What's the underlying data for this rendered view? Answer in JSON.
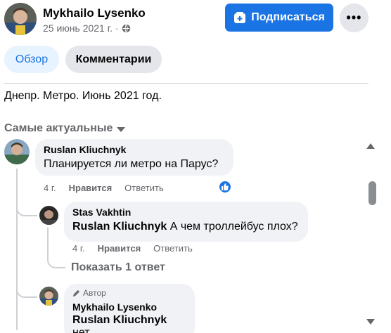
{
  "post": {
    "author": "Mykhailo Lysenko",
    "date": "25 июнь 2021 г. ·",
    "text": "Днепр. Метро. Июнь 2021 год."
  },
  "header": {
    "subscribe_label": "Подписаться",
    "more_label": "•••"
  },
  "tabs": [
    {
      "label": "Обзор",
      "active": true
    },
    {
      "label": "Комментарии",
      "active": false
    }
  ],
  "sort": {
    "label": "Самые актуальные"
  },
  "comments": [
    {
      "author": "Ruslan Kliuchnyk",
      "text": "Планируется ли метро на Парус?",
      "time": "4 г.",
      "like_label": "Нравится",
      "reply_label": "Ответить",
      "reaction": "like"
    },
    {
      "author": "Stas Vakhtin",
      "mention": "Ruslan Kliuchnyk",
      "text": " А чем троллейбус плох?",
      "time": "4 г.",
      "like_label": "Нравится",
      "reply_label": "Ответить",
      "more_replies": "Показать 1 ответ"
    },
    {
      "badge": "Автор",
      "author": "Mykhailo Lysenko",
      "mention": "Ruslan Kliuchnyk",
      "text": " нет"
    }
  ],
  "colors": {
    "accent": "#1b74e4",
    "bubble": "#f0f2f5",
    "muted_text": "#65676b"
  }
}
